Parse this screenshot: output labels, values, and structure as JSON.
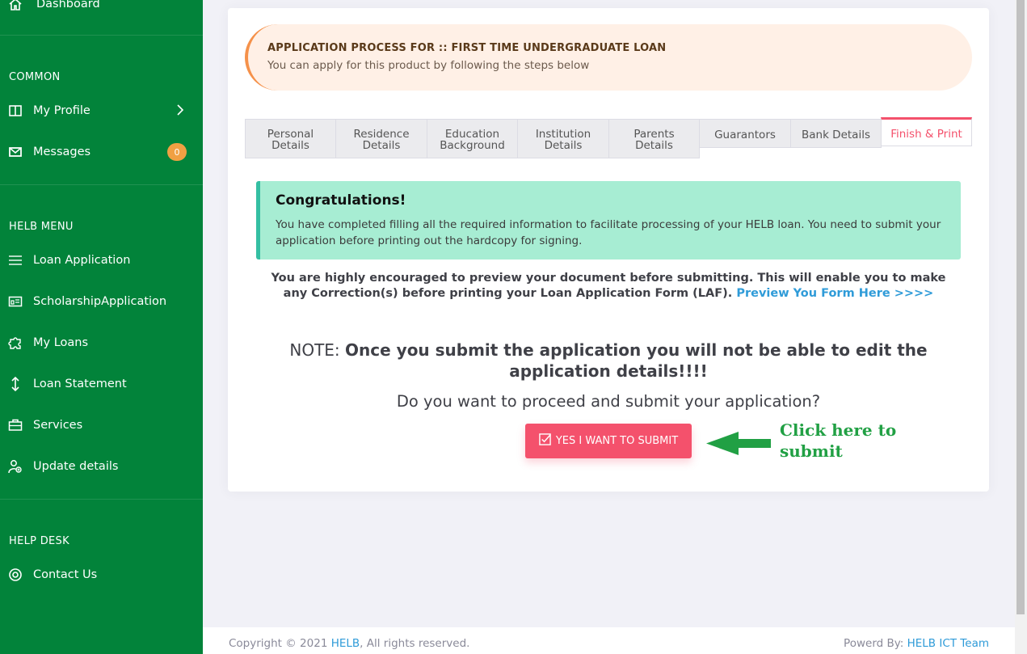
{
  "sidebar": {
    "dashboard": "Dashboard",
    "sections": {
      "common": "COMMON",
      "helb_menu": "HELB MENU",
      "help_desk": "HELP DESK"
    },
    "my_profile": "My Profile",
    "messages": "Messages",
    "messages_badge": "0",
    "loan_application": "Loan Application",
    "scholarship_application": "ScholarshipApplication",
    "my_loans": "My Loans",
    "loan_statement": "Loan Statement",
    "services": "Services",
    "update_details": "Update details",
    "contact_us": "Contact Us"
  },
  "banner": {
    "title": "APPLICATION PROCESS FOR :: FIRST TIME UNDERGRADUATE LOAN",
    "subtitle": "You can apply for this product by following the steps below"
  },
  "tabs": {
    "personal": [
      "Personal",
      "Details"
    ],
    "residence": [
      "Residence",
      "Details"
    ],
    "education": [
      "Education",
      "Background"
    ],
    "institution": [
      "Institution",
      "Details"
    ],
    "parents": [
      "Parents",
      "Details"
    ],
    "guarantors": "Guarantors",
    "bank": "Bank Details",
    "finish": "Finish & Print"
  },
  "alert": {
    "heading": "Congratulations!",
    "body": "You have completed filling all the required information to facilitate processing of your HELB loan. You need to submit your application before printing out the hardcopy for signing."
  },
  "encourage": {
    "text": "You are highly encouraged to preview your document before submitting. This will enable you to make any Correction(s) before printing your Loan Application Form (LAF).",
    "link": "Preview You Form Here >>>>"
  },
  "note": {
    "prefix": "NOTE:",
    "bold": "Once you submit the application you will not be able to edit the application details!!!!"
  },
  "question": "Do you want to proceed and submit your application?",
  "submit_label": "YES I WANT TO SUBMIT",
  "click_hint": "Click here to submit",
  "colors": {
    "sidebar": "#02833a",
    "danger": "#f4516c",
    "success_bg": "#a7edd3",
    "link": "#2f9bd8",
    "hint": "#21a044"
  },
  "footer": {
    "copyright_prefix": "Copyright © 2021",
    "org_link": "HELB",
    "copyright_suffix": ", All rights reserved.",
    "powered_prefix": "Powerd By:",
    "powered_link": "HELB ICT Team"
  }
}
